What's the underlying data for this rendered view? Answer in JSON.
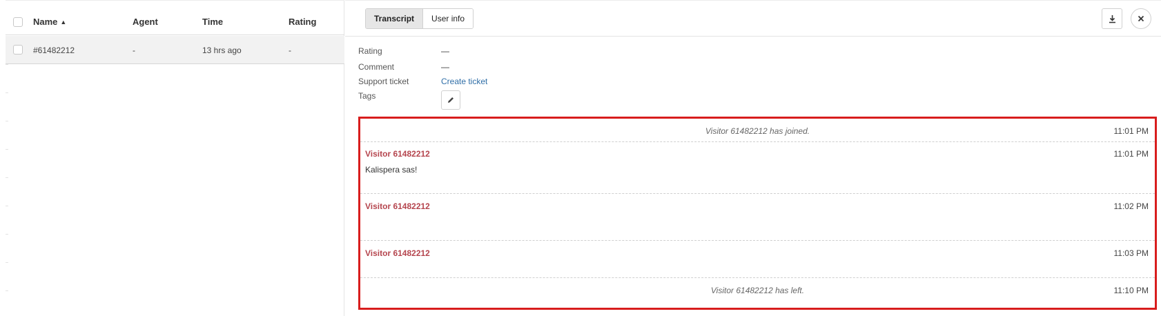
{
  "table": {
    "headers": {
      "name": "Name",
      "agent": "Agent",
      "time": "Time",
      "rating": "Rating"
    },
    "sort_indicator": "▲",
    "rows": [
      {
        "name": "#61482212",
        "agent": "-",
        "time": "13 hrs ago",
        "rating": "-"
      }
    ]
  },
  "tabs": [
    {
      "label": "Transcript",
      "active": true
    },
    {
      "label": "User info",
      "active": false
    }
  ],
  "details": {
    "rating_label": "Rating",
    "rating_value": "—",
    "comment_label": "Comment",
    "comment_value": "—",
    "ticket_label": "Support ticket",
    "ticket_link": "Create ticket",
    "tags_label": "Tags"
  },
  "icons": {
    "download": "download-icon",
    "close": "close-icon",
    "edit": "pencil-icon"
  },
  "transcript": {
    "messages": [
      {
        "type": "system",
        "text": "Visitor 61482212 has joined.",
        "time": "11:01 PM"
      },
      {
        "type": "message",
        "sender": "Visitor 61482212",
        "text": "Kalispera sas!",
        "time": "11:01 PM"
      },
      {
        "type": "message",
        "sender": "Visitor 61482212",
        "text": "",
        "time": "11:02 PM"
      },
      {
        "type": "message",
        "sender": "Visitor 61482212",
        "text": "",
        "time": "11:03 PM"
      },
      {
        "type": "system",
        "text": "Visitor 61482212 has left.",
        "time": "11:10 PM"
      }
    ]
  },
  "colors": {
    "highlight_border": "#d81d1d",
    "sender": "#b5454e",
    "link": "#2f6ea7"
  }
}
